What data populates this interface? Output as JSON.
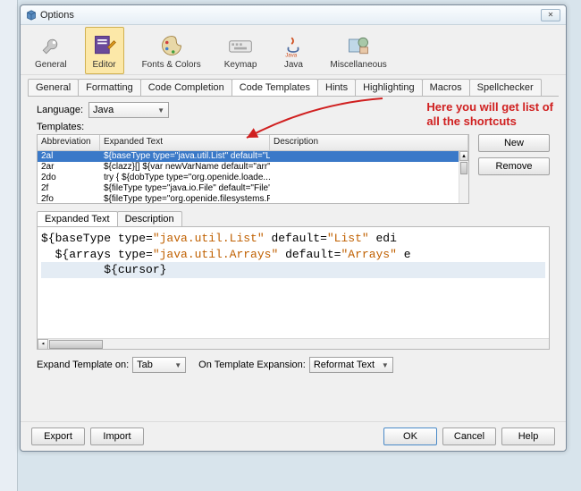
{
  "window": {
    "title": "Options"
  },
  "toolbar": {
    "items": [
      {
        "label": "General"
      },
      {
        "label": "Editor"
      },
      {
        "label": "Fonts & Colors"
      },
      {
        "label": "Keymap"
      },
      {
        "label": "Java"
      },
      {
        "label": "Miscellaneous"
      }
    ]
  },
  "tabs": [
    "General",
    "Formatting",
    "Code Completion",
    "Code Templates",
    "Hints",
    "Highlighting",
    "Macros",
    "Spellchecker"
  ],
  "lang": {
    "label": "Language:",
    "value": "Java"
  },
  "templates_label": "Templates:",
  "annotation": {
    "line1": "Here you will get list of",
    "line2": "all the shortcuts"
  },
  "cols": {
    "abbr": "Abbreviation",
    "exp": "Expanded Text",
    "desc": "Description"
  },
  "rows": [
    {
      "a": "2al",
      "e": "${baseType type=\"java.util.List\" default=\"Li..."
    },
    {
      "a": "2ar",
      "e": "${clazz}[] ${var newVarName default=\"arr\"..."
    },
    {
      "a": "2do",
      "e": "try {   ${dobType type=\"org.openide.loade..."
    },
    {
      "a": "2f",
      "e": "${fileType type=\"java.io.File\" default=\"File\"..."
    },
    {
      "a": "2fo",
      "e": "${fileType type=\"org.openide.filesystems.Fi..."
    }
  ],
  "sidebtns": {
    "new": "New",
    "remove": "Remove"
  },
  "subtabs": {
    "expanded": "Expanded Text",
    "desc": "Description"
  },
  "code": {
    "l1a": "${baseType type=",
    "l1b": "\"java.util.List\"",
    "l1c": " default=",
    "l1d": "\"List\"",
    "l1e": " edi",
    "l2a": "  ${arrays type=",
    "l2b": "\"java.util.Arrays\"",
    "l2c": " default=",
    "l2d": "\"Arrays\"",
    "l2e": " e",
    "l3": "         ${cursor}"
  },
  "bottom": {
    "expand_label": "Expand Template on:",
    "expand_value": "Tab",
    "onexp_label": "On Template Expansion:",
    "onexp_value": "Reformat Text"
  },
  "footer": {
    "export": "Export",
    "import": "Import",
    "ok": "OK",
    "cancel": "Cancel",
    "help": "Help"
  }
}
